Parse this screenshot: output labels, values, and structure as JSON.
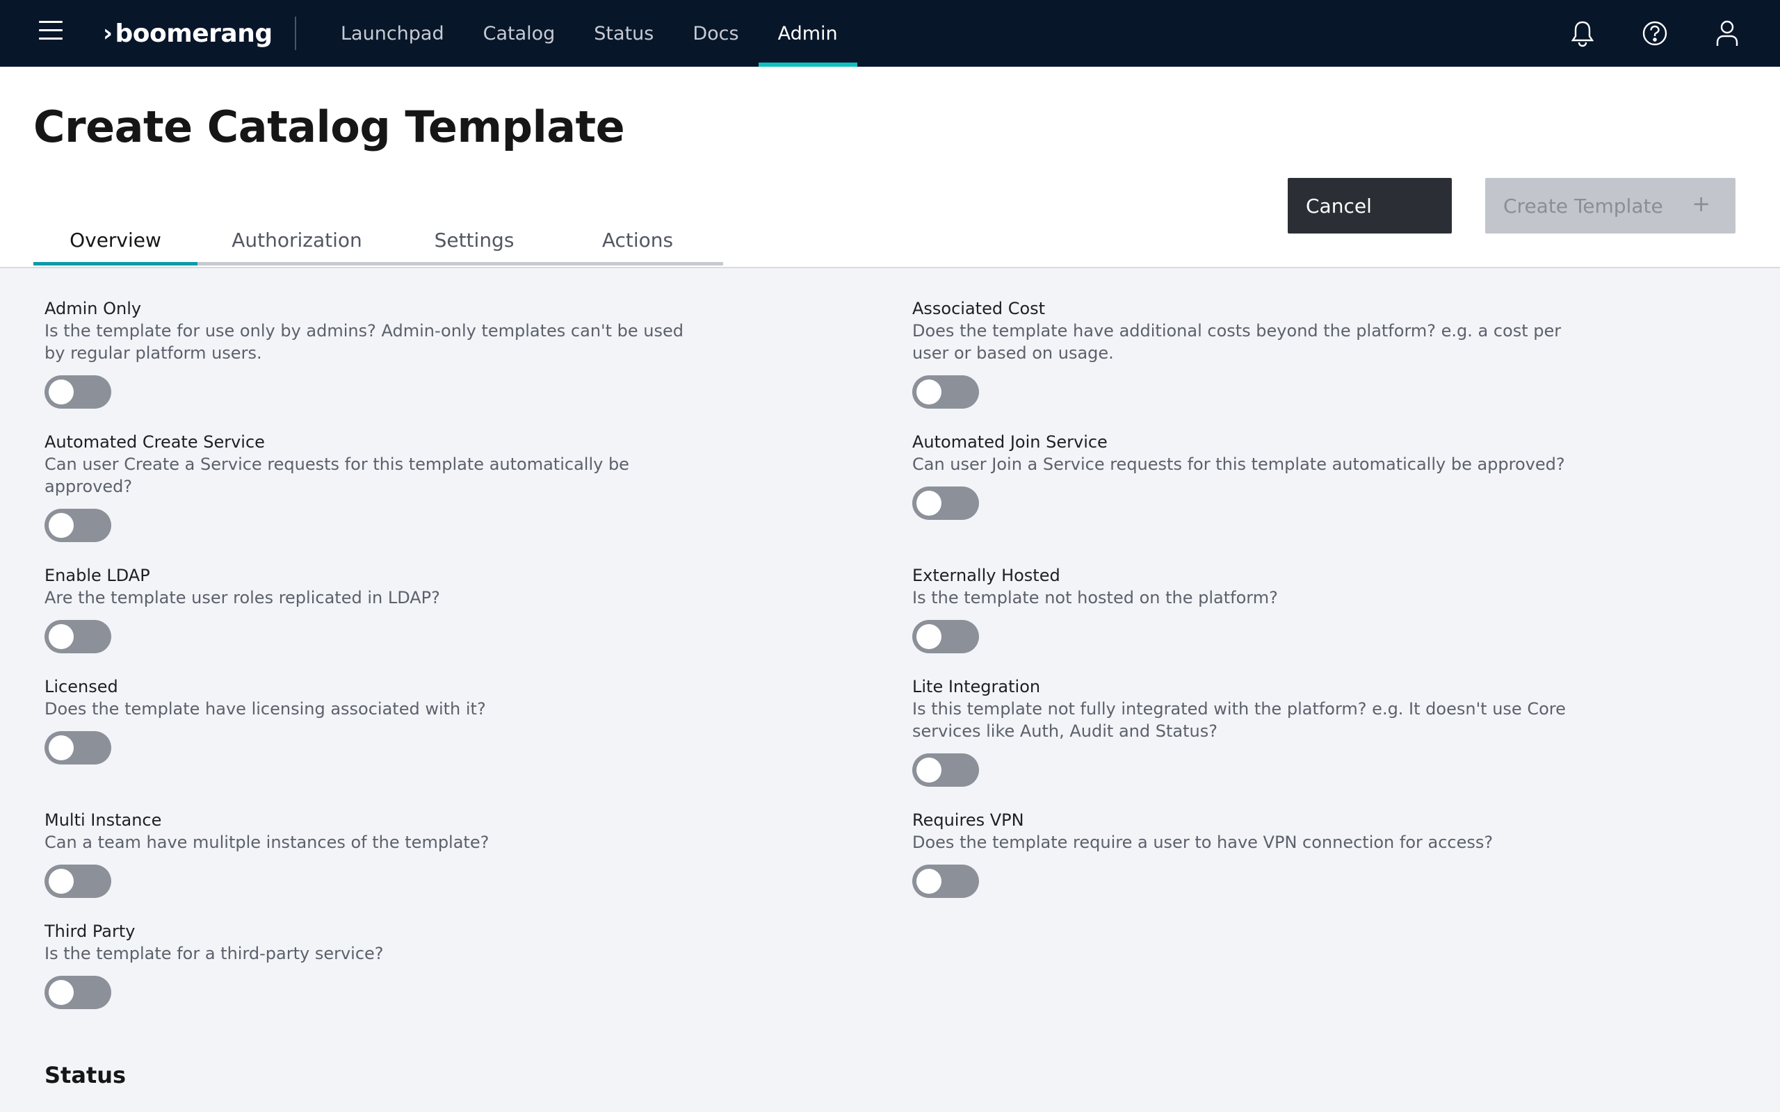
{
  "brand": {
    "name": "boomerang"
  },
  "nav": {
    "items": [
      "Launchpad",
      "Catalog",
      "Status",
      "Docs",
      "Admin"
    ],
    "active": "Admin"
  },
  "top_icons": [
    "bell-icon",
    "help-icon",
    "user-icon"
  ],
  "page": {
    "title": "Create Catalog Template"
  },
  "buttons": {
    "cancel": "Cancel",
    "create": "Create Template",
    "create_icon": "+"
  },
  "tabs": [
    "Overview",
    "Authorization",
    "Settings",
    "Actions"
  ],
  "active_tab": "Overview",
  "fields": [
    {
      "label": "Admin Only",
      "desc": "Is the template for use only by admins? Admin-only templates can't be used by regular platform users.",
      "on": false
    },
    {
      "label": "Associated Cost",
      "desc": "Does the template have additional costs beyond the platform? e.g. a cost per user or based on usage.",
      "on": false
    },
    {
      "label": "Automated Create Service",
      "desc": "Can user Create a Service requests for this template automatically be approved?",
      "on": false
    },
    {
      "label": "Automated Join Service",
      "desc": "Can user Join a Service requests for this template automatically be approved?",
      "on": false
    },
    {
      "label": "Enable LDAP",
      "desc": "Are the template user roles replicated in LDAP?",
      "on": false
    },
    {
      "label": "Externally Hosted",
      "desc": "Is the template not hosted on the platform?",
      "on": false
    },
    {
      "label": "Licensed",
      "desc": "Does the template have licensing associated with it?",
      "on": false
    },
    {
      "label": "Lite Integration",
      "desc": "Is this template not fully integrated with the platform? e.g. It doesn't use Core services like Auth, Audit and Status?",
      "on": false
    },
    {
      "label": "Multi Instance",
      "desc": "Can a team have mulitple instances of the template?",
      "on": false
    },
    {
      "label": "Requires VPN",
      "desc": "Does the template require a user to have VPN connection for access?",
      "on": false
    },
    {
      "label": "Third Party",
      "desc": "Is the template for a third-party service?",
      "on": false
    }
  ],
  "sections": {
    "status": "Status"
  },
  "colors": {
    "nav_bg": "#08162a",
    "accent": "#10c0bf",
    "toggle_off": "#8b9099",
    "page_bg": "#f3f4f8"
  }
}
